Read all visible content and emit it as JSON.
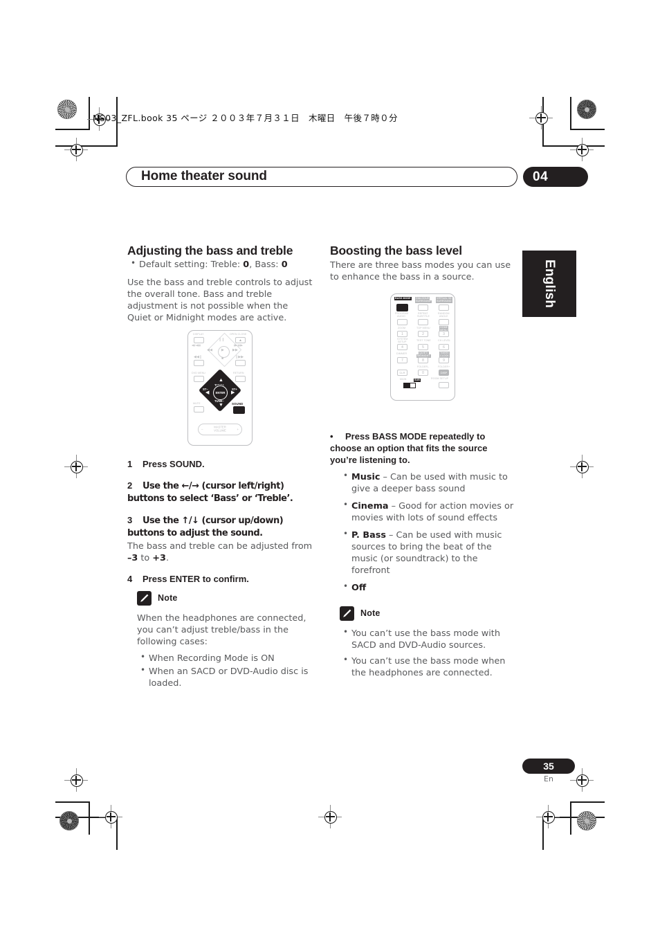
{
  "header": {
    "filename_line": "NS03_ZFL.book  35 ページ  ２００３年７月３１日　木曜日　午後７時０分",
    "chapter_title": "Home theater sound",
    "chapter_number": "04"
  },
  "side_tab": {
    "label": "English"
  },
  "footer": {
    "page_number": "35",
    "page_lang": "En"
  },
  "left_column": {
    "heading": "Adjusting the bass and treble",
    "default_setting_prefix": "Default setting: Treble: ",
    "default_treble": "0",
    "default_mid": ", Bass: ",
    "default_bass": "0",
    "intro": "Use the bass and treble controls to adjust the overall tone. Bass and treble adjustment is not possible when the Quiet or Midnight modes are active.",
    "steps": [
      {
        "n": "1",
        "text": "Press SOUND."
      },
      {
        "n": "2",
        "text": "Use the ←/→ (cursor left/right) buttons to select ‘Bass’ or ‘Treble’."
      },
      {
        "n": "3",
        "text": "Use the ↑/↓ (cursor up/down) buttons to adjust the sound."
      },
      {
        "n": "4",
        "text": "Press ENTER to confirm."
      }
    ],
    "step3_sub_a": "The bass and treble can be adjusted from ",
    "step3_sub_b": "–3",
    "step3_sub_c": " to ",
    "step3_sub_d": "+3",
    "step3_sub_e": ".",
    "note": {
      "label": "Note",
      "intro": "When the headphones are connected, you can’t adjust treble/bass in the following cases:",
      "items": [
        "When Recording Mode is ON",
        "When an SACD or DVD-Audio disc is loaded."
      ]
    }
  },
  "right_column": {
    "heading": "Boosting the bass level",
    "intro": "There are three bass modes you can use to enhance the bass in a source.",
    "instruction": "Press BASS MODE repeatedly to choose an option that fits the source you’re listening to.",
    "options": [
      {
        "name": "Music",
        "desc": " – Can be used with music to give a deeper bass sound"
      },
      {
        "name": "Cinema",
        "desc": " – Good for action movies or movies with lots of sound effects"
      },
      {
        "name": "P. Bass",
        "desc": " – Can be used with music sources to bring the beat of the music (or soundtrack) to the forefront"
      },
      {
        "name": "Off",
        "desc": ""
      }
    ],
    "note": {
      "label": "Note",
      "items": [
        "You can’t use the bass mode with SACD and DVD-Audio sources.",
        "You can’t use the bass mode when the headphones are connected."
      ]
    }
  },
  "remote_a": {
    "labels": {
      "display": "DISPLAY",
      "open_close": "OPEN CLOSE",
      "prev_chapter": "◀▮/◀▮▮",
      "next_chapter": "▮▶/▮▮▶",
      "dvd_menu": "DVD MENU",
      "return": "RETURN",
      "mute": "MUTE",
      "sound": "SOUND",
      "tune_up": "TUNE+",
      "tune_down": "TUNE–",
      "st_minus": "ST–",
      "st_plus": "ST+",
      "enter": "ENTER",
      "master": "MASTER",
      "volume": "VOLUME",
      "minus": "–",
      "plus": "+"
    }
  },
  "remote_b": {
    "labels": {
      "bass_mode": "BASS MODE",
      "dialogue": "DIALOGUE",
      "surround": "SURROUND",
      "virtual_3d": "VIRTUAL 3D",
      "virtual_surround": "SURROUND",
      "program": "PROGRAM",
      "audio": "AUDIO",
      "repeat": "REPEAT",
      "subtitle": "SUBTITLE",
      "random": "RANDOM",
      "angle": "ANGLE",
      "zoom": "ZOOM",
      "top_menu": "TOP MENU",
      "home": "HOME",
      "menu": "MENU",
      "system": "SYSTEM",
      "setup": "SETUP",
      "test_tone": "TEST TONE",
      "ch_level": "CH LEVEL",
      "dimmer": "DIMMER",
      "quiet": "QUIET/",
      "midnight": "MIDNIGHT",
      "timer": "TIMER/",
      "clock": "CLOCK",
      "clr": "CLR",
      "folder_down": "FOLDER–",
      "folder_up": "FOLDER+",
      "disp": "DISP",
      "room_setup": "ROOM SETUP",
      "main": "MAIN",
      "sub": "SUB",
      "n1": "1",
      "n2": "2",
      "n3": "3",
      "n4": "4",
      "n5": "5",
      "n6": "6",
      "n7": "7",
      "n8": "8",
      "n9": "9",
      "n0": "0"
    }
  }
}
